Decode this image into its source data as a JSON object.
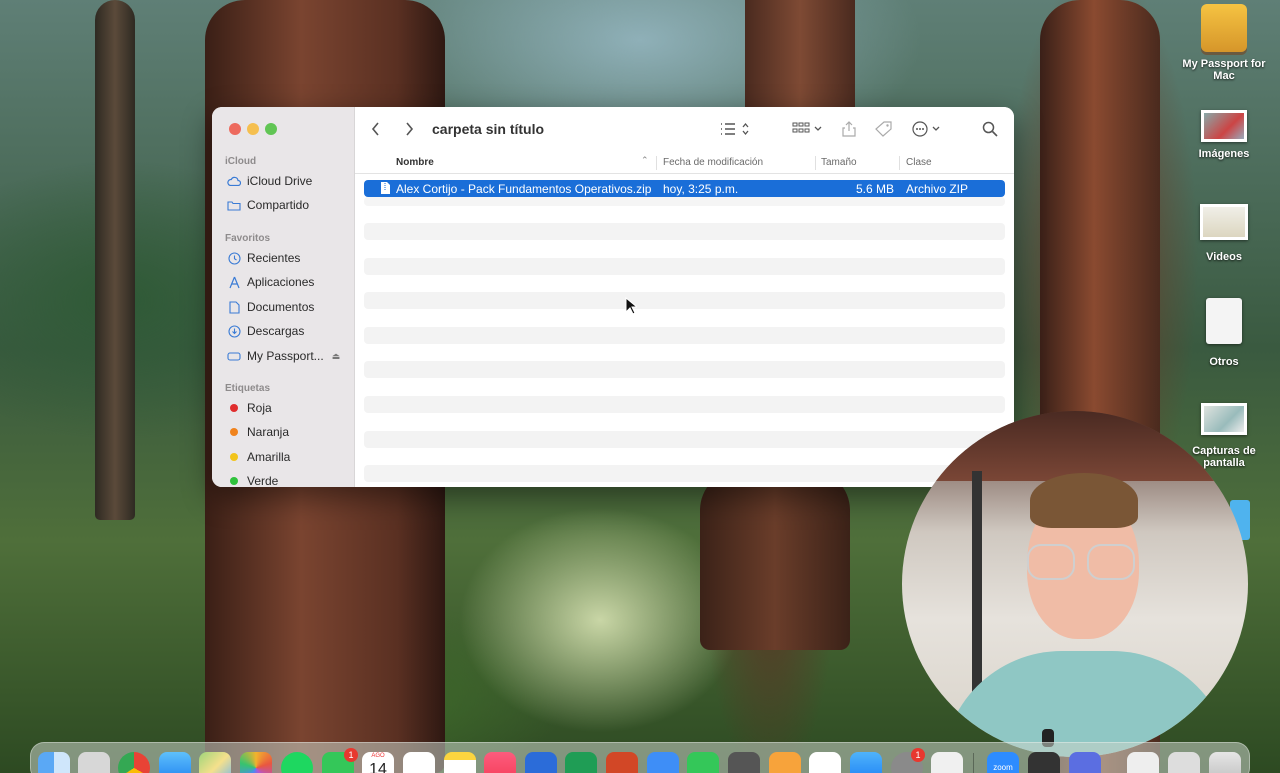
{
  "finder": {
    "title": "carpeta sin título",
    "sidebar": {
      "icloud_title": "iCloud",
      "icloud_items": [
        {
          "label": "iCloud Drive",
          "icon": "cloud-icon"
        },
        {
          "label": "Compartido",
          "icon": "shared-folder-icon"
        }
      ],
      "favorites_title": "Favoritos",
      "favorites_items": [
        {
          "label": "Recientes",
          "icon": "clock-icon"
        },
        {
          "label": "Aplicaciones",
          "icon": "apps-icon"
        },
        {
          "label": "Documentos",
          "icon": "document-icon"
        },
        {
          "label": "Descargas",
          "icon": "download-icon"
        },
        {
          "label": "My Passport...",
          "icon": "drive-icon"
        }
      ],
      "tags_title": "Etiquetas",
      "tags": [
        {
          "label": "Roja",
          "color": "#e02d2d"
        },
        {
          "label": "Naranja",
          "color": "#f0831d"
        },
        {
          "label": "Amarilla",
          "color": "#f2c41b"
        },
        {
          "label": "Verde",
          "color": "#2fc23b"
        }
      ]
    },
    "columns": {
      "name": "Nombre",
      "modified": "Fecha de modificación",
      "size": "Tamaño",
      "kind": "Clase"
    },
    "files": [
      {
        "name": "Alex Cortijo - Pack Fundamentos Operativos.zip",
        "modified": "hoy, 3:25 p.m.",
        "size": "5.6 MB",
        "kind": "Archivo ZIP"
      }
    ],
    "accent": "#1a6ed8"
  },
  "desktop": {
    "icons": [
      {
        "label": "My Passport for Mac",
        "icon": "external-drive-icon"
      },
      {
        "label": "Imágenes",
        "icon": "images-stack-icon"
      },
      {
        "label": "Videos",
        "icon": "videos-stack-icon"
      },
      {
        "label": "Otros",
        "icon": "zip-file-icon"
      },
      {
        "label": "Capturas de pantalla",
        "icon": "screenshots-stack-icon"
      }
    ]
  },
  "dock": {
    "calendar_month": "AGO",
    "calendar_day": "14",
    "zoom_label": "zoom",
    "badge_facetime": "1",
    "badge_settings": "1"
  }
}
